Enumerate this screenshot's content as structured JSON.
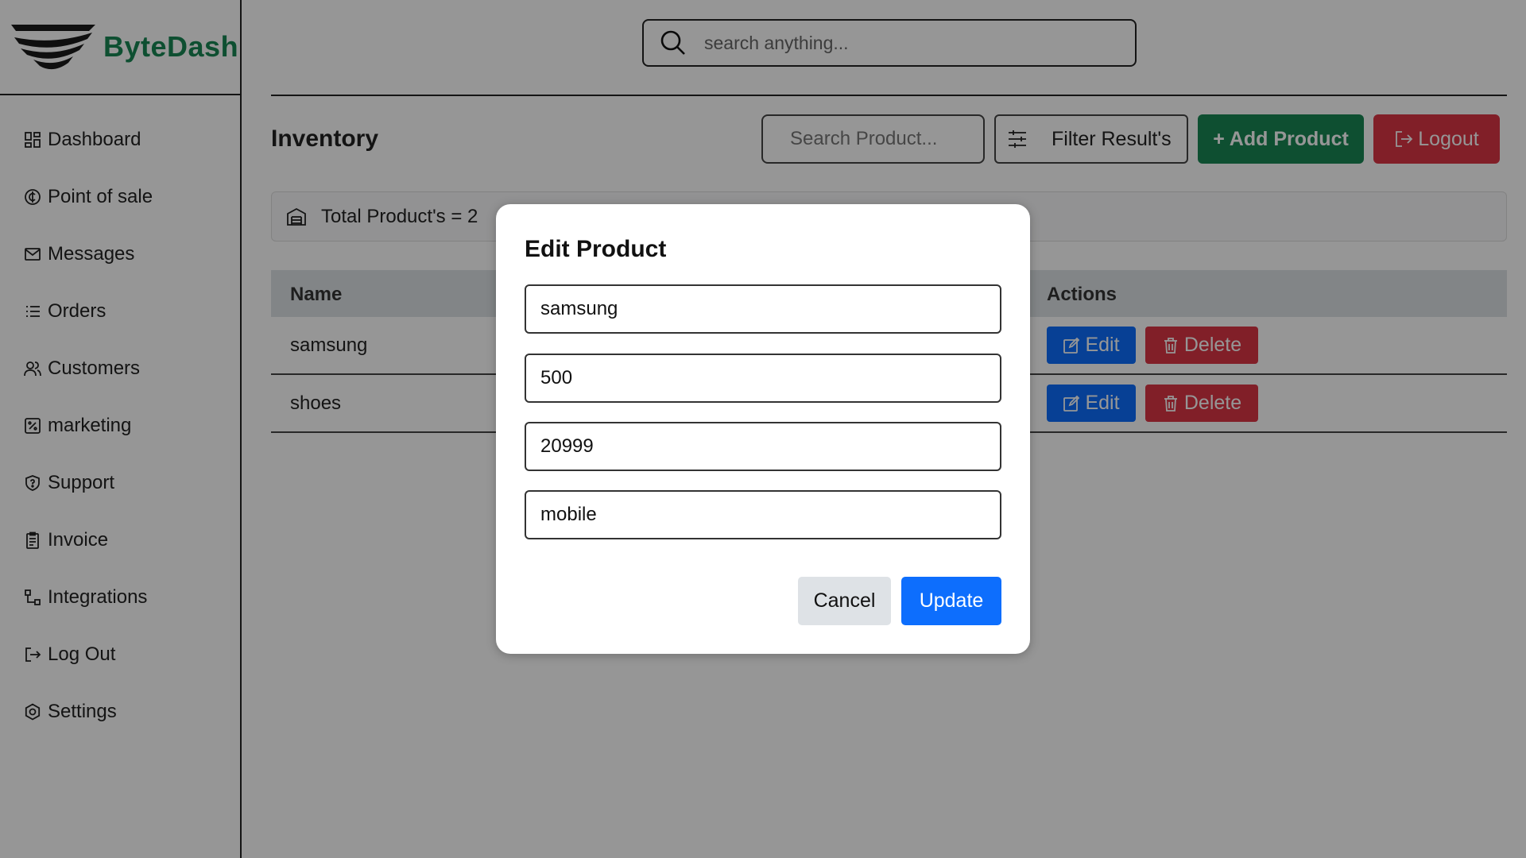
{
  "brand": {
    "name": "ByteDash",
    "color": "#198754"
  },
  "sidebar": {
    "items": [
      {
        "label": "Dashboard",
        "icon": "dashboard-icon"
      },
      {
        "label": "Point of sale",
        "icon": "currency-icon"
      },
      {
        "label": "Messages",
        "icon": "envelope-icon"
      },
      {
        "label": "Orders",
        "icon": "list-icon"
      },
      {
        "label": "Customers",
        "icon": "people-icon"
      },
      {
        "label": "marketing",
        "icon": "percent-icon"
      },
      {
        "label": "Support",
        "icon": "shield-icon"
      },
      {
        "label": "Invoice",
        "icon": "clipboard-icon"
      },
      {
        "label": "Integrations",
        "icon": "diagram-icon"
      },
      {
        "label": "Log Out",
        "icon": "logout-icon"
      },
      {
        "label": "Settings",
        "icon": "gear-icon"
      }
    ]
  },
  "header": {
    "search_placeholder": "search anything..."
  },
  "inventory": {
    "title": "Inventory",
    "search_placeholder": "Search Product...",
    "filter_label": "Filter Result's",
    "add_label": "+ Add Product",
    "logout_label": "Logout",
    "total_text": "Total Product's = 2"
  },
  "table": {
    "columns": {
      "name": "Name",
      "actions": "Actions"
    },
    "rows": [
      {
        "name": "samsung",
        "edit": "Edit",
        "delete": "Delete"
      },
      {
        "name": "shoes",
        "edit": "Edit",
        "delete": "Delete"
      }
    ]
  },
  "modal": {
    "title": "Edit Product",
    "fields": [
      "samsung",
      "500",
      "20999",
      "mobile"
    ],
    "cancel_label": "Cancel",
    "update_label": "Update"
  },
  "colors": {
    "primary": "#0d6efd",
    "success": "#198754",
    "danger": "#dc3545"
  }
}
